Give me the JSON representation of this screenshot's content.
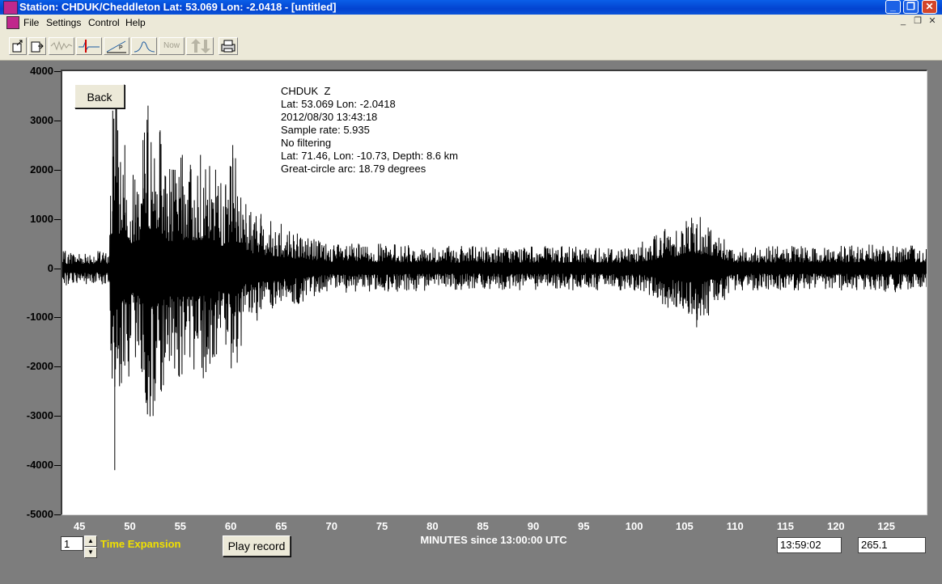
{
  "window": {
    "title": "Station: CHDUK/Cheddleton Lat: 53.069 Lon: -2.0418 - [untitled]"
  },
  "menu": {
    "items": [
      "File",
      "Settings",
      "Control",
      "Help"
    ]
  },
  "toolbar": {
    "now_label": "Now"
  },
  "plot": {
    "back_label": "Back",
    "info_lines": [
      "CHDUK  Z",
      "Lat: 53.069 Lon: -2.0418",
      "2012/08/30 13:43:18",
      "Sample rate: 5.935",
      "No filtering",
      "Lat: 71.46, Lon: -10.73, Depth: 8.6 km",
      "Great-circle arc: 18.79 degrees"
    ],
    "y_ticks": [
      "4000",
      "3000",
      "2000",
      "1000",
      "0",
      "-1000",
      "-2000",
      "-3000",
      "-4000",
      "-5000"
    ],
    "x_ticks": [
      "45",
      "50",
      "55",
      "60",
      "65",
      "70",
      "75",
      "80",
      "85",
      "90",
      "95",
      "100",
      "105",
      "110",
      "115",
      "120",
      "125"
    ],
    "x_label": "MINUTES since 13:00:00 UTC"
  },
  "controls": {
    "time_expansion_value": "1",
    "time_expansion_label": "Time Expansion",
    "play_label": "Play record",
    "time_readout": "13:59:02",
    "value_readout": "265.1"
  },
  "chart_data": {
    "type": "line",
    "x_unit": "minutes since 13:00:00 UTC",
    "xlim": [
      43.3,
      129.0
    ],
    "ylim": [
      -5000,
      4000
    ],
    "series": [
      {
        "x": [
          43.3,
          47.9,
          48.3,
          48.5,
          48.8,
          49.5,
          50.5,
          51.3,
          51.8,
          52.3,
          53.0,
          54.2,
          55.2,
          56.0,
          57.0,
          58.5,
          59.5,
          60.2,
          61.5,
          63.0,
          65.0,
          70.0,
          75.0,
          80.0,
          85.0,
          90.0,
          95.0,
          100.0,
          106.2,
          110.0,
          115.0,
          120.0,
          125.0,
          129.0
        ],
        "y": [
          350,
          350,
          3200,
          -4100,
          2800,
          2500,
          1800,
          2600,
          3300,
          -3000,
          2800,
          2000,
          2300,
          2100,
          2300,
          2000,
          1700,
          2500,
          1300,
          1100,
          900,
          500,
          500,
          450,
          450,
          450,
          450,
          450,
          -1200,
          450,
          450,
          450,
          500,
          450
        ]
      }
    ]
  }
}
